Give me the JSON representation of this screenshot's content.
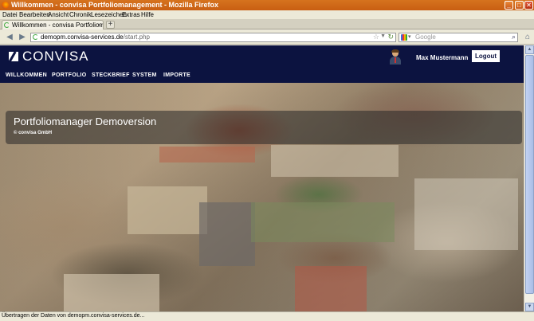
{
  "window": {
    "title": "Willkommen - convisa Portfoliomanagement - Mozilla Firefox",
    "buttons": {
      "minimize": "_",
      "maximize": "□",
      "close": "✕"
    }
  },
  "menubar": [
    "Datei",
    "Bearbeiten",
    "Ansicht",
    "Chronik",
    "Lesezeichen",
    "Extras",
    "Hilfe"
  ],
  "tab": {
    "label": "Willkommen - convisa Portfoliomanagement",
    "close": "×",
    "new": "+"
  },
  "navigation": {
    "back": "◀",
    "forward": "▶",
    "url_domain": "demopm.convisa-services.de",
    "url_path": "/start.php",
    "search_placeholder": "Google",
    "home": "⌂"
  },
  "site": {
    "logo": "CONVISA",
    "user_name": "Max Mustermann",
    "logout_label": "Logout",
    "nav": [
      "WILLKOMMEN",
      "PORTFOLIO",
      "STECKBRIEF",
      "SYSTEM",
      "IMPORTE"
    ],
    "banner_title": "Portfoliomanager Demoversion",
    "banner_sub": "© convisa GmbH"
  },
  "status": "Übertragen der Daten von demopm.convisa-services.de...",
  "colors": {
    "brand_navy": "#0c1340",
    "titlebar": "#d6731e"
  }
}
